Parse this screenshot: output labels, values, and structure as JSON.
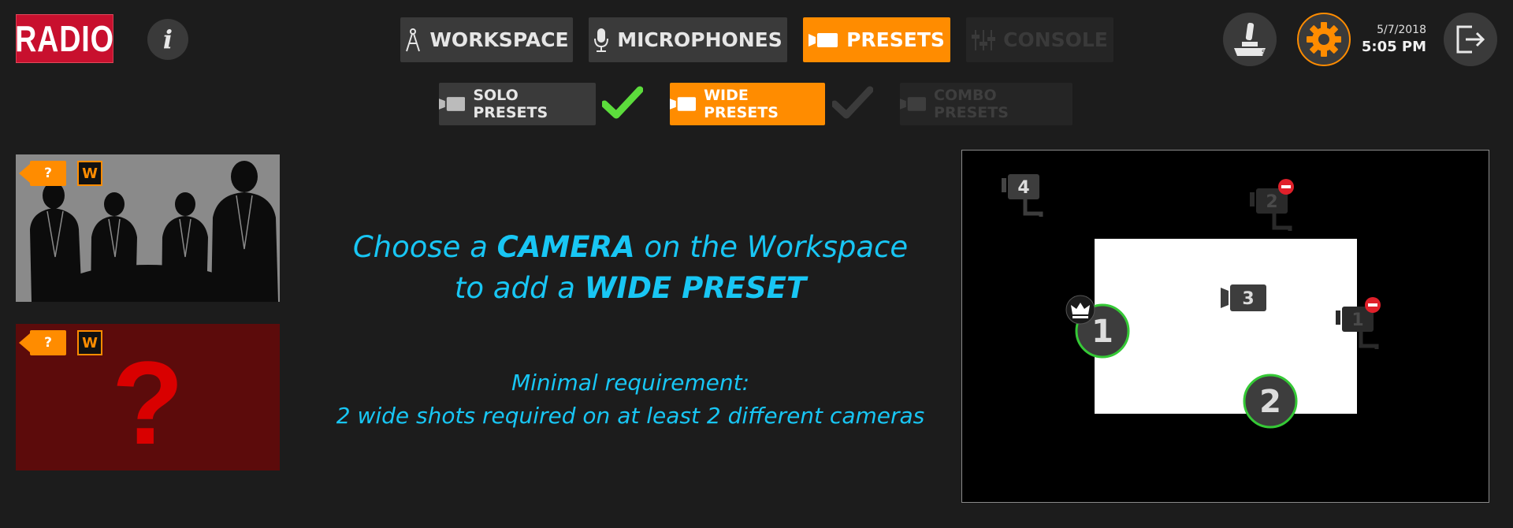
{
  "header": {
    "logo_text": "RADIO",
    "info_label": "i",
    "nav": {
      "workspace": "WORKSPACE",
      "microphones": "MICROPHONES",
      "presets": "PRESETS",
      "console": "CONSOLE"
    },
    "date": "5/7/2018",
    "time": "5:05 PM"
  },
  "subtabs": {
    "solo": "SOLO PRESETS",
    "wide": "WIDE PRESETS",
    "combo": "COMBO PRESETS"
  },
  "presets": [
    {
      "camera_label": "?",
      "type_label": "W"
    },
    {
      "camera_label": "?",
      "type_label": "W",
      "placeholder": "?"
    }
  ],
  "instructions": {
    "line1_pre": "Choose a ",
    "line1_bold": "CAMERA",
    "line1_post": " on the Workspace",
    "line2_pre": "to add a ",
    "line2_bold": "WIDE PRESET",
    "req_line1": "Minimal requirement:",
    "req_line2": "2 wide shots required on at least 2 different cameras"
  },
  "map": {
    "cameras": [
      {
        "id": "cam4",
        "label": "4",
        "status": "dimmed"
      },
      {
        "id": "cam2-off",
        "label": "2",
        "status": "disabled"
      },
      {
        "id": "cam3",
        "label": "3",
        "status": "dimmed"
      },
      {
        "id": "cam1-off",
        "label": "1",
        "status": "disabled"
      }
    ],
    "seats": [
      {
        "label": "1",
        "role": "host"
      },
      {
        "label": "2",
        "role": "guest"
      }
    ]
  },
  "colors": {
    "accent": "#ff8c00",
    "logo_red": "#c8102e",
    "text_cyan": "#18c6f4",
    "check_green": "#5cdc3c",
    "seat_ring": "#35c936",
    "disabled_red": "#e0202a"
  },
  "icons": [
    "compass-icon",
    "microphone-icon",
    "camera-icon",
    "sliders-icon",
    "joystick-icon",
    "gear-icon",
    "logout-icon",
    "check-icon",
    "crown-icon",
    "no-entry-icon"
  ]
}
